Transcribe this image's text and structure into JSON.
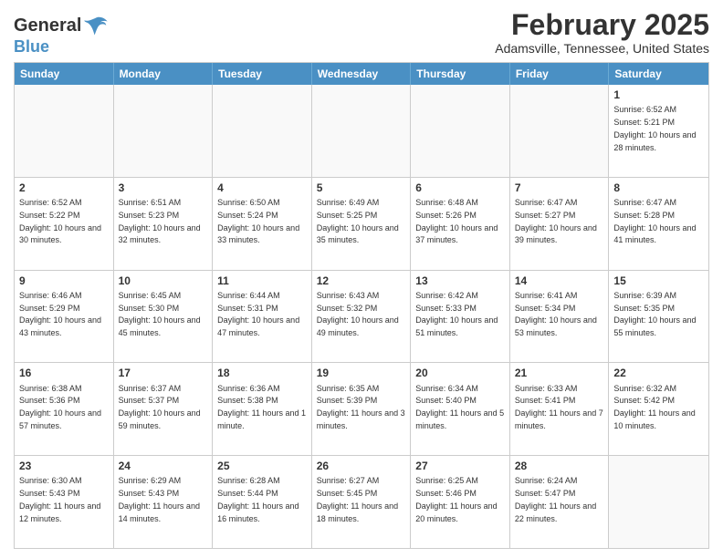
{
  "header": {
    "logo_general": "General",
    "logo_blue": "Blue",
    "month_title": "February 2025",
    "location": "Adamsville, Tennessee, United States"
  },
  "weekdays": [
    "Sunday",
    "Monday",
    "Tuesday",
    "Wednesday",
    "Thursday",
    "Friday",
    "Saturday"
  ],
  "rows": [
    [
      {
        "day": "",
        "info": ""
      },
      {
        "day": "",
        "info": ""
      },
      {
        "day": "",
        "info": ""
      },
      {
        "day": "",
        "info": ""
      },
      {
        "day": "",
        "info": ""
      },
      {
        "day": "",
        "info": ""
      },
      {
        "day": "1",
        "info": "Sunrise: 6:52 AM\nSunset: 5:21 PM\nDaylight: 10 hours and 28 minutes."
      }
    ],
    [
      {
        "day": "2",
        "info": "Sunrise: 6:52 AM\nSunset: 5:22 PM\nDaylight: 10 hours and 30 minutes."
      },
      {
        "day": "3",
        "info": "Sunrise: 6:51 AM\nSunset: 5:23 PM\nDaylight: 10 hours and 32 minutes."
      },
      {
        "day": "4",
        "info": "Sunrise: 6:50 AM\nSunset: 5:24 PM\nDaylight: 10 hours and 33 minutes."
      },
      {
        "day": "5",
        "info": "Sunrise: 6:49 AM\nSunset: 5:25 PM\nDaylight: 10 hours and 35 minutes."
      },
      {
        "day": "6",
        "info": "Sunrise: 6:48 AM\nSunset: 5:26 PM\nDaylight: 10 hours and 37 minutes."
      },
      {
        "day": "7",
        "info": "Sunrise: 6:47 AM\nSunset: 5:27 PM\nDaylight: 10 hours and 39 minutes."
      },
      {
        "day": "8",
        "info": "Sunrise: 6:47 AM\nSunset: 5:28 PM\nDaylight: 10 hours and 41 minutes."
      }
    ],
    [
      {
        "day": "9",
        "info": "Sunrise: 6:46 AM\nSunset: 5:29 PM\nDaylight: 10 hours and 43 minutes."
      },
      {
        "day": "10",
        "info": "Sunrise: 6:45 AM\nSunset: 5:30 PM\nDaylight: 10 hours and 45 minutes."
      },
      {
        "day": "11",
        "info": "Sunrise: 6:44 AM\nSunset: 5:31 PM\nDaylight: 10 hours and 47 minutes."
      },
      {
        "day": "12",
        "info": "Sunrise: 6:43 AM\nSunset: 5:32 PM\nDaylight: 10 hours and 49 minutes."
      },
      {
        "day": "13",
        "info": "Sunrise: 6:42 AM\nSunset: 5:33 PM\nDaylight: 10 hours and 51 minutes."
      },
      {
        "day": "14",
        "info": "Sunrise: 6:41 AM\nSunset: 5:34 PM\nDaylight: 10 hours and 53 minutes."
      },
      {
        "day": "15",
        "info": "Sunrise: 6:39 AM\nSunset: 5:35 PM\nDaylight: 10 hours and 55 minutes."
      }
    ],
    [
      {
        "day": "16",
        "info": "Sunrise: 6:38 AM\nSunset: 5:36 PM\nDaylight: 10 hours and 57 minutes."
      },
      {
        "day": "17",
        "info": "Sunrise: 6:37 AM\nSunset: 5:37 PM\nDaylight: 10 hours and 59 minutes."
      },
      {
        "day": "18",
        "info": "Sunrise: 6:36 AM\nSunset: 5:38 PM\nDaylight: 11 hours and 1 minute."
      },
      {
        "day": "19",
        "info": "Sunrise: 6:35 AM\nSunset: 5:39 PM\nDaylight: 11 hours and 3 minutes."
      },
      {
        "day": "20",
        "info": "Sunrise: 6:34 AM\nSunset: 5:40 PM\nDaylight: 11 hours and 5 minutes."
      },
      {
        "day": "21",
        "info": "Sunrise: 6:33 AM\nSunset: 5:41 PM\nDaylight: 11 hours and 7 minutes."
      },
      {
        "day": "22",
        "info": "Sunrise: 6:32 AM\nSunset: 5:42 PM\nDaylight: 11 hours and 10 minutes."
      }
    ],
    [
      {
        "day": "23",
        "info": "Sunrise: 6:30 AM\nSunset: 5:43 PM\nDaylight: 11 hours and 12 minutes."
      },
      {
        "day": "24",
        "info": "Sunrise: 6:29 AM\nSunset: 5:43 PM\nDaylight: 11 hours and 14 minutes."
      },
      {
        "day": "25",
        "info": "Sunrise: 6:28 AM\nSunset: 5:44 PM\nDaylight: 11 hours and 16 minutes."
      },
      {
        "day": "26",
        "info": "Sunrise: 6:27 AM\nSunset: 5:45 PM\nDaylight: 11 hours and 18 minutes."
      },
      {
        "day": "27",
        "info": "Sunrise: 6:25 AM\nSunset: 5:46 PM\nDaylight: 11 hours and 20 minutes."
      },
      {
        "day": "28",
        "info": "Sunrise: 6:24 AM\nSunset: 5:47 PM\nDaylight: 11 hours and 22 minutes."
      },
      {
        "day": "",
        "info": ""
      }
    ]
  ]
}
